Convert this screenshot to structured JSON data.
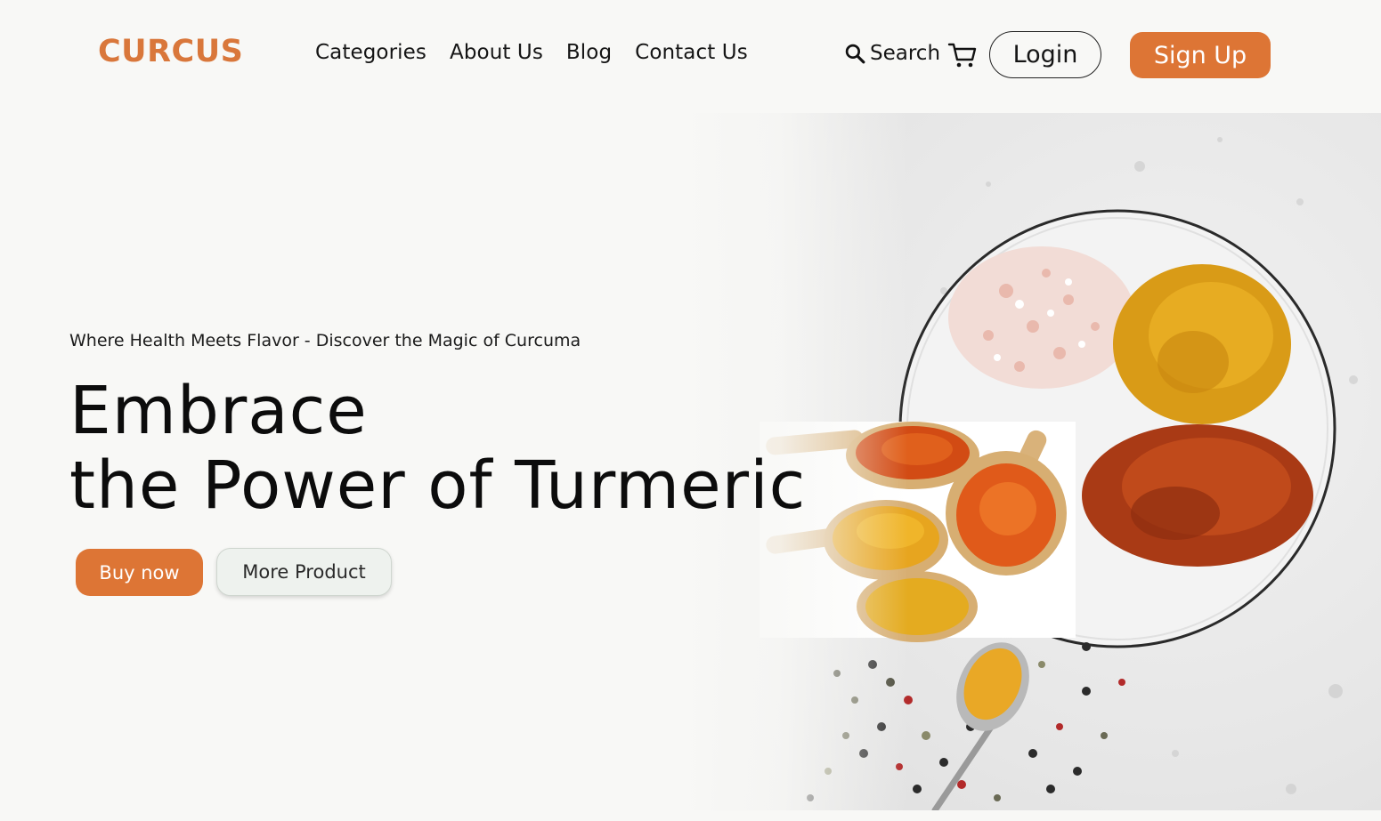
{
  "brand": {
    "logo": "CURCUS",
    "accent_color": "#dd7535"
  },
  "nav": {
    "items": [
      {
        "label": "Categories"
      },
      {
        "label": "About Us"
      },
      {
        "label": "Blog"
      },
      {
        "label": "Contact Us"
      }
    ]
  },
  "header": {
    "search_label": "Search",
    "search_icon": "magnifier-icon",
    "cart_icon": "cart-icon",
    "login_label": "Login",
    "signup_label": "Sign Up"
  },
  "hero": {
    "tagline": "Where Health Meets Flavor - Discover the Magic of Curcuma",
    "headline_line1": "Embrace",
    "headline_line2": "the Power of Turmeric",
    "buy_label": "Buy now",
    "more_label": "More Product",
    "image": "spices-on-marble-photo"
  }
}
